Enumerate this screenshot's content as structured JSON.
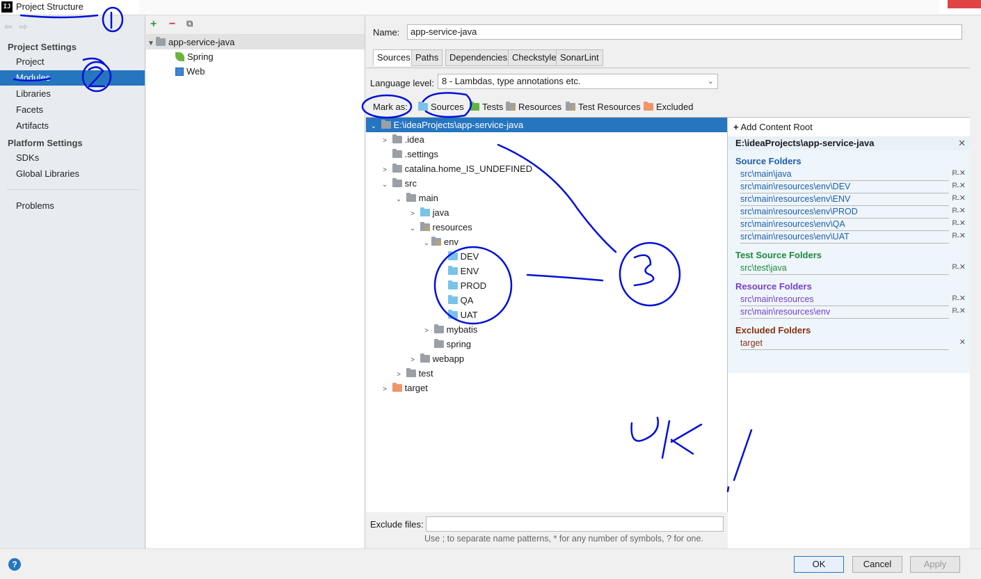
{
  "window": {
    "title": "Project Structure",
    "icon_text": "IJ"
  },
  "left_nav": {
    "project_settings_title": "Project Settings",
    "project_items": [
      "Project",
      "Modules",
      "Libraries",
      "Facets",
      "Artifacts"
    ],
    "platform_settings_title": "Platform Settings",
    "platform_items": [
      "SDKs",
      "Global Libraries"
    ],
    "other_items": [
      "Problems"
    ],
    "selected": "Modules"
  },
  "modules": {
    "items": [
      {
        "label": "app-service-java",
        "icon": "module-folder-icon",
        "level": 0,
        "expanded": true
      },
      {
        "label": "Spring",
        "icon": "spring-icon",
        "level": 1
      },
      {
        "label": "Web",
        "icon": "web-icon",
        "level": 1
      }
    ]
  },
  "module_settings": {
    "name_label": "Name:",
    "name_value": "app-service-java",
    "tabs": [
      "Sources",
      "Paths",
      "Dependencies",
      "Checkstyle",
      "SonarLint"
    ],
    "active_tab": "Sources",
    "language_level_label": "Language level:",
    "language_level_value": "8 - Lambdas, type annotations etc.",
    "mark_as_label": "Mark as:",
    "mark_as_options": [
      "Sources",
      "Tests",
      "Resources",
      "Test Resources",
      "Excluded"
    ],
    "exclude_files_label": "Exclude files:",
    "exclude_files_value": "",
    "exclude_hint": "Use ; to separate name patterns, * for any number of symbols, ? for one."
  },
  "tree": [
    {
      "label": "E:\\ideaProjects\\app-service-java",
      "level": 0,
      "caret": "down",
      "folder": "gray",
      "selected": true
    },
    {
      "label": ".idea",
      "level": 1,
      "caret": "right",
      "folder": "gray"
    },
    {
      "label": ".settings",
      "level": 1,
      "caret": "",
      "folder": "gray"
    },
    {
      "label": "catalina.home_IS_UNDEFINED",
      "level": 1,
      "caret": "right",
      "folder": "gray"
    },
    {
      "label": "src",
      "level": 1,
      "caret": "down",
      "folder": "gray"
    },
    {
      "label": "main",
      "level": 2,
      "caret": "down",
      "folder": "gray"
    },
    {
      "label": "java",
      "level": 3,
      "caret": "right",
      "folder": "blue"
    },
    {
      "label": "resources",
      "level": 3,
      "caret": "down",
      "folder": "res"
    },
    {
      "label": "env",
      "level": 4,
      "caret": "down",
      "folder": "res"
    },
    {
      "label": "DEV",
      "level": 5,
      "caret": "",
      "folder": "blue"
    },
    {
      "label": "ENV",
      "level": 5,
      "caret": "",
      "folder": "blue"
    },
    {
      "label": "PROD",
      "level": 5,
      "caret": "",
      "folder": "blue"
    },
    {
      "label": "QA",
      "level": 5,
      "caret": "",
      "folder": "blue"
    },
    {
      "label": "UAT",
      "level": 5,
      "caret": "",
      "folder": "blue"
    },
    {
      "label": "mybatis",
      "level": 4,
      "caret": "right",
      "folder": "gray"
    },
    {
      "label": "spring",
      "level": 4,
      "caret": "",
      "folder": "gray"
    },
    {
      "label": "webapp",
      "level": 3,
      "caret": "right",
      "folder": "gray"
    },
    {
      "label": "test",
      "level": 2,
      "caret": "right",
      "folder": "gray"
    },
    {
      "label": "target",
      "level": 1,
      "caret": "right",
      "folder": "orange"
    }
  ],
  "content_roots": {
    "add_label": "Add Content Root",
    "root_path": "E:\\ideaProjects\\app-service-java",
    "source_folders_title": "Source Folders",
    "source_folders": [
      "src\\main\\java",
      "src\\main\\resources\\env\\DEV",
      "src\\main\\resources\\env\\ENV",
      "src\\main\\resources\\env\\PROD",
      "src\\main\\resources\\env\\QA",
      "src\\main\\resources\\env\\UAT"
    ],
    "test_folders_title": "Test Source Folders",
    "test_folders": [
      "src\\test\\java"
    ],
    "resource_folders_title": "Resource Folders",
    "resource_folders": [
      "src\\main\\resources",
      "src\\main\\resources\\env"
    ],
    "excluded_folders_title": "Excluded Folders",
    "excluded_folders": [
      "target"
    ],
    "colors": {
      "source": "#1f5fa8",
      "test": "#1d8a3a",
      "resource": "#7a3fc8",
      "excluded": "#8a3010"
    }
  },
  "buttons": {
    "ok": "OK",
    "cancel": "Cancel",
    "apply": "Apply"
  },
  "annotations": [
    "1",
    "2",
    "3",
    "OK",
    "!"
  ]
}
